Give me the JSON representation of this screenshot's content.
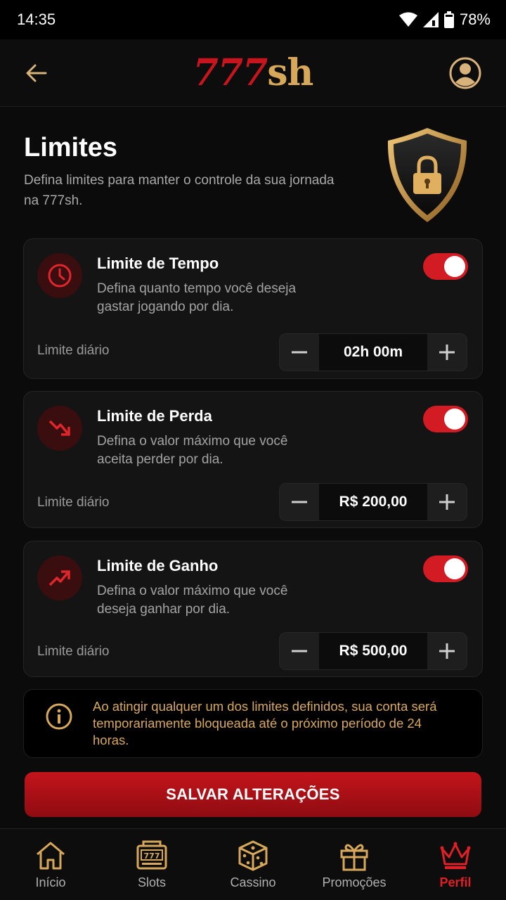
{
  "status_bar": {
    "time": "14:35",
    "battery": "78%"
  },
  "header": {
    "logo_part1": "777",
    "logo_part2": "sh"
  },
  "intro": {
    "title": "Limites",
    "description": "Defina limites para manter o controle da sua jornada na 777sh."
  },
  "cards": [
    {
      "title": "Limite de Tempo",
      "description": "Defina quanto tempo você deseja gastar jogando por dia.",
      "enabled": true,
      "limit_label": "Limite diário",
      "value": "02h 00m",
      "icon": "clock-icon"
    },
    {
      "title": "Limite de Perda",
      "description": "Defina o valor máximo que você aceita perder por dia.",
      "enabled": true,
      "limit_label": "Limite diário",
      "value": "R$ 200,00",
      "icon": "trending-down-icon"
    },
    {
      "title": "Limite de Ganho",
      "description": "Defina o valor máximo que você deseja ganhar por dia.",
      "enabled": true,
      "limit_label": "Limite diário",
      "value": "R$ 500,00",
      "icon": "trending-up-icon"
    }
  ],
  "info": {
    "text": "Ao atingir qualquer um dos limites definidos, sua conta será temporariamente bloqueada até o próximo período de 24 horas."
  },
  "save_button": {
    "label": "SALVAR ALTERAÇÕES"
  },
  "nav": [
    {
      "label": "Início",
      "icon": "home-icon",
      "active": false
    },
    {
      "label": "Slots",
      "icon": "slot-machine-icon",
      "active": false
    },
    {
      "label": "Cassino",
      "icon": "dice-icon",
      "active": false
    },
    {
      "label": "Promoções",
      "icon": "gift-icon",
      "active": false
    },
    {
      "label": "Perfil",
      "icon": "crown-icon",
      "active": true
    }
  ],
  "colors": {
    "accent_red": "#d21b22",
    "gold": "#d8a85a",
    "background": "#0b0b0b"
  }
}
